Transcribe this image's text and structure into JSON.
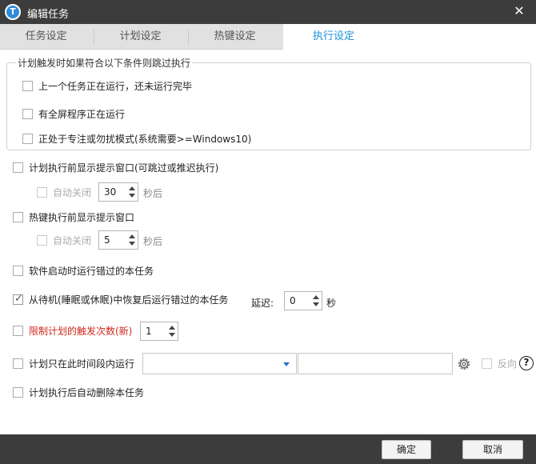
{
  "window": {
    "title": "编辑任务",
    "app_icon_letter": "T"
  },
  "tabs": [
    {
      "label": "任务设定",
      "active": false
    },
    {
      "label": "计划设定",
      "active": false
    },
    {
      "label": "热键设定",
      "active": false
    },
    {
      "label": "执行设定",
      "active": true
    }
  ],
  "skip_group": {
    "legend": "计划触发时如果符合以下条件则跳过执行",
    "items": [
      {
        "label": "上一个任务正在运行，还未运行完毕",
        "checked": false
      },
      {
        "label": "有全屏程序正在运行",
        "checked": false
      },
      {
        "label": "正处于专注或勿扰模式(系统需要>=Windows10)",
        "checked": false
      }
    ]
  },
  "options": {
    "plan_prompt": {
      "label": "计划执行前显示提示窗口(可跳过或推迟执行)",
      "checked": false,
      "auto_close_label": "自动关闭",
      "auto_close_checked": false,
      "seconds_value": "30",
      "seconds_unit": "秒后"
    },
    "hotkey_prompt": {
      "label": "热键执行前显示提示窗口",
      "checked": false,
      "auto_close_label": "自动关闭",
      "auto_close_checked": false,
      "seconds_value": "5",
      "seconds_unit": "秒后"
    },
    "startup_missed": {
      "label": "软件启动时运行错过的本任务",
      "checked": false
    },
    "resume_missed": {
      "label": "从待机(睡眠或休眠)中恢复后运行错过的本任务",
      "checked": true,
      "delay_label": "延迟:",
      "delay_value": "0",
      "delay_unit": "秒"
    },
    "limit_count": {
      "label": "限制计划的触发次数(新)",
      "checked": false,
      "value": "1",
      "color": "#d0281c"
    },
    "time_window": {
      "label": "计划只在此时间段内运行",
      "checked": false,
      "combo_value": "",
      "text_value": "",
      "reverse_label": "反向",
      "reverse_checked": false,
      "help_label": "?"
    },
    "delete_after": {
      "label": "计划执行后自动删除本任务",
      "checked": false
    }
  },
  "footer": {
    "ok_label": "确定",
    "cancel_label": "取消"
  },
  "colors": {
    "accent": "#1e90d8",
    "titlebar": "#3c3c3c",
    "warning_text": "#d0281c"
  },
  "icons": {
    "close": "close-icon",
    "gear": "gear-icon",
    "help": "help-icon",
    "combo_arrow": "chevron-down-icon"
  }
}
